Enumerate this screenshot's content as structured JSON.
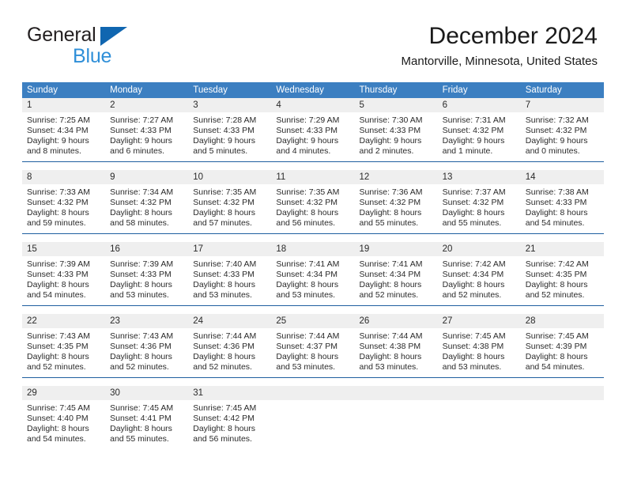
{
  "brand": {
    "name_part1": "General",
    "name_part2": "Blue",
    "logo_icon": "triangle-logo-icon",
    "color_dark": "#231f20",
    "color_blue": "#2f8fd8",
    "color_triangle": "#1066b0"
  },
  "header": {
    "month_title": "December 2024",
    "location": "Mantorville, Minnesota, United States"
  },
  "colors": {
    "header_bar": "#3c7fc1",
    "week_divider": "#1f5fa0",
    "date_band": "#efefef",
    "cell_text": "#2a2a2a"
  },
  "weekdays": [
    "Sunday",
    "Monday",
    "Tuesday",
    "Wednesday",
    "Thursday",
    "Friday",
    "Saturday"
  ],
  "weeks": [
    {
      "days": [
        {
          "num": "1",
          "sunrise": "Sunrise: 7:25 AM",
          "sunset": "Sunset: 4:34 PM",
          "daylight1": "Daylight: 9 hours",
          "daylight2": "and 8 minutes."
        },
        {
          "num": "2",
          "sunrise": "Sunrise: 7:27 AM",
          "sunset": "Sunset: 4:33 PM",
          "daylight1": "Daylight: 9 hours",
          "daylight2": "and 6 minutes."
        },
        {
          "num": "3",
          "sunrise": "Sunrise: 7:28 AM",
          "sunset": "Sunset: 4:33 PM",
          "daylight1": "Daylight: 9 hours",
          "daylight2": "and 5 minutes."
        },
        {
          "num": "4",
          "sunrise": "Sunrise: 7:29 AM",
          "sunset": "Sunset: 4:33 PM",
          "daylight1": "Daylight: 9 hours",
          "daylight2": "and 4 minutes."
        },
        {
          "num": "5",
          "sunrise": "Sunrise: 7:30 AM",
          "sunset": "Sunset: 4:33 PM",
          "daylight1": "Daylight: 9 hours",
          "daylight2": "and 2 minutes."
        },
        {
          "num": "6",
          "sunrise": "Sunrise: 7:31 AM",
          "sunset": "Sunset: 4:32 PM",
          "daylight1": "Daylight: 9 hours",
          "daylight2": "and 1 minute."
        },
        {
          "num": "7",
          "sunrise": "Sunrise: 7:32 AM",
          "sunset": "Sunset: 4:32 PM",
          "daylight1": "Daylight: 9 hours",
          "daylight2": "and 0 minutes."
        }
      ]
    },
    {
      "days": [
        {
          "num": "8",
          "sunrise": "Sunrise: 7:33 AM",
          "sunset": "Sunset: 4:32 PM",
          "daylight1": "Daylight: 8 hours",
          "daylight2": "and 59 minutes."
        },
        {
          "num": "9",
          "sunrise": "Sunrise: 7:34 AM",
          "sunset": "Sunset: 4:32 PM",
          "daylight1": "Daylight: 8 hours",
          "daylight2": "and 58 minutes."
        },
        {
          "num": "10",
          "sunrise": "Sunrise: 7:35 AM",
          "sunset": "Sunset: 4:32 PM",
          "daylight1": "Daylight: 8 hours",
          "daylight2": "and 57 minutes."
        },
        {
          "num": "11",
          "sunrise": "Sunrise: 7:35 AM",
          "sunset": "Sunset: 4:32 PM",
          "daylight1": "Daylight: 8 hours",
          "daylight2": "and 56 minutes."
        },
        {
          "num": "12",
          "sunrise": "Sunrise: 7:36 AM",
          "sunset": "Sunset: 4:32 PM",
          "daylight1": "Daylight: 8 hours",
          "daylight2": "and 55 minutes."
        },
        {
          "num": "13",
          "sunrise": "Sunrise: 7:37 AM",
          "sunset": "Sunset: 4:32 PM",
          "daylight1": "Daylight: 8 hours",
          "daylight2": "and 55 minutes."
        },
        {
          "num": "14",
          "sunrise": "Sunrise: 7:38 AM",
          "sunset": "Sunset: 4:33 PM",
          "daylight1": "Daylight: 8 hours",
          "daylight2": "and 54 minutes."
        }
      ]
    },
    {
      "days": [
        {
          "num": "15",
          "sunrise": "Sunrise: 7:39 AM",
          "sunset": "Sunset: 4:33 PM",
          "daylight1": "Daylight: 8 hours",
          "daylight2": "and 54 minutes."
        },
        {
          "num": "16",
          "sunrise": "Sunrise: 7:39 AM",
          "sunset": "Sunset: 4:33 PM",
          "daylight1": "Daylight: 8 hours",
          "daylight2": "and 53 minutes."
        },
        {
          "num": "17",
          "sunrise": "Sunrise: 7:40 AM",
          "sunset": "Sunset: 4:33 PM",
          "daylight1": "Daylight: 8 hours",
          "daylight2": "and 53 minutes."
        },
        {
          "num": "18",
          "sunrise": "Sunrise: 7:41 AM",
          "sunset": "Sunset: 4:34 PM",
          "daylight1": "Daylight: 8 hours",
          "daylight2": "and 53 minutes."
        },
        {
          "num": "19",
          "sunrise": "Sunrise: 7:41 AM",
          "sunset": "Sunset: 4:34 PM",
          "daylight1": "Daylight: 8 hours",
          "daylight2": "and 52 minutes."
        },
        {
          "num": "20",
          "sunrise": "Sunrise: 7:42 AM",
          "sunset": "Sunset: 4:34 PM",
          "daylight1": "Daylight: 8 hours",
          "daylight2": "and 52 minutes."
        },
        {
          "num": "21",
          "sunrise": "Sunrise: 7:42 AM",
          "sunset": "Sunset: 4:35 PM",
          "daylight1": "Daylight: 8 hours",
          "daylight2": "and 52 minutes."
        }
      ]
    },
    {
      "days": [
        {
          "num": "22",
          "sunrise": "Sunrise: 7:43 AM",
          "sunset": "Sunset: 4:35 PM",
          "daylight1": "Daylight: 8 hours",
          "daylight2": "and 52 minutes."
        },
        {
          "num": "23",
          "sunrise": "Sunrise: 7:43 AM",
          "sunset": "Sunset: 4:36 PM",
          "daylight1": "Daylight: 8 hours",
          "daylight2": "and 52 minutes."
        },
        {
          "num": "24",
          "sunrise": "Sunrise: 7:44 AM",
          "sunset": "Sunset: 4:36 PM",
          "daylight1": "Daylight: 8 hours",
          "daylight2": "and 52 minutes."
        },
        {
          "num": "25",
          "sunrise": "Sunrise: 7:44 AM",
          "sunset": "Sunset: 4:37 PM",
          "daylight1": "Daylight: 8 hours",
          "daylight2": "and 53 minutes."
        },
        {
          "num": "26",
          "sunrise": "Sunrise: 7:44 AM",
          "sunset": "Sunset: 4:38 PM",
          "daylight1": "Daylight: 8 hours",
          "daylight2": "and 53 minutes."
        },
        {
          "num": "27",
          "sunrise": "Sunrise: 7:45 AM",
          "sunset": "Sunset: 4:38 PM",
          "daylight1": "Daylight: 8 hours",
          "daylight2": "and 53 minutes."
        },
        {
          "num": "28",
          "sunrise": "Sunrise: 7:45 AM",
          "sunset": "Sunset: 4:39 PM",
          "daylight1": "Daylight: 8 hours",
          "daylight2": "and 54 minutes."
        }
      ]
    },
    {
      "days": [
        {
          "num": "29",
          "sunrise": "Sunrise: 7:45 AM",
          "sunset": "Sunset: 4:40 PM",
          "daylight1": "Daylight: 8 hours",
          "daylight2": "and 54 minutes."
        },
        {
          "num": "30",
          "sunrise": "Sunrise: 7:45 AM",
          "sunset": "Sunset: 4:41 PM",
          "daylight1": "Daylight: 8 hours",
          "daylight2": "and 55 minutes."
        },
        {
          "num": "31",
          "sunrise": "Sunrise: 7:45 AM",
          "sunset": "Sunset: 4:42 PM",
          "daylight1": "Daylight: 8 hours",
          "daylight2": "and 56 minutes."
        },
        {
          "num": "",
          "sunrise": "",
          "sunset": "",
          "daylight1": "",
          "daylight2": ""
        },
        {
          "num": "",
          "sunrise": "",
          "sunset": "",
          "daylight1": "",
          "daylight2": ""
        },
        {
          "num": "",
          "sunrise": "",
          "sunset": "",
          "daylight1": "",
          "daylight2": ""
        },
        {
          "num": "",
          "sunrise": "",
          "sunset": "",
          "daylight1": "",
          "daylight2": ""
        }
      ]
    }
  ]
}
